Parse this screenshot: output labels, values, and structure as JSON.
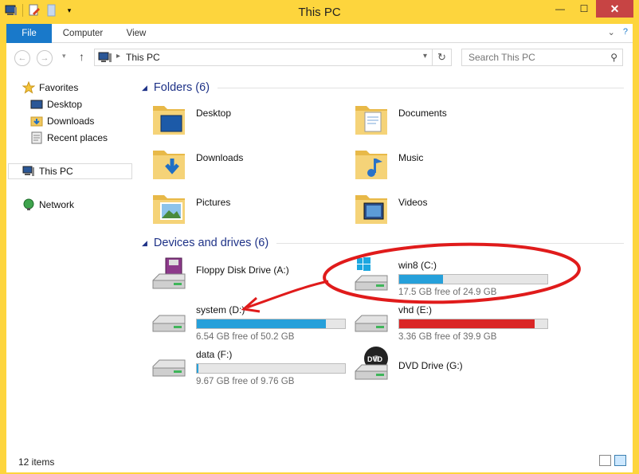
{
  "window": {
    "title": "This PC"
  },
  "ribbon": {
    "tabs": [
      {
        "label": "File"
      },
      {
        "label": "Computer"
      },
      {
        "label": "View"
      }
    ]
  },
  "address": {
    "crumb": "This PC",
    "search_placeholder": "Search This PC"
  },
  "sidebar": {
    "favorites_label": "Favorites",
    "favorites": [
      {
        "label": "Desktop"
      },
      {
        "label": "Downloads"
      },
      {
        "label": "Recent places"
      }
    ],
    "this_pc_label": "This PC",
    "network_label": "Network"
  },
  "folders": {
    "header": "Folders (6)",
    "items": [
      {
        "name": "Desktop",
        "icon": "desktop-folder-icon"
      },
      {
        "name": "Documents",
        "icon": "documents-folder-icon"
      },
      {
        "name": "Downloads",
        "icon": "downloads-folder-icon"
      },
      {
        "name": "Music",
        "icon": "music-folder-icon"
      },
      {
        "name": "Pictures",
        "icon": "pictures-folder-icon"
      },
      {
        "name": "Videos",
        "icon": "videos-folder-icon"
      }
    ]
  },
  "drives": {
    "header": "Devices and drives (6)",
    "items": [
      {
        "name": "Floppy Disk Drive (A:)",
        "icon": "floppy-drive-icon"
      },
      {
        "name": "win8 (C:)",
        "icon": "windows-drive-icon",
        "used_fraction": 0.297,
        "free_text": "17.5 GB free of 24.9 GB"
      },
      {
        "name": "system (D:)",
        "icon": "hard-drive-icon",
        "used_fraction": 0.87,
        "free_text": "6.54 GB free of 50.2 GB"
      },
      {
        "name": "vhd (E:)",
        "icon": "hard-drive-icon",
        "used_fraction": 0.916,
        "free_text": "3.36 GB free of 39.9 GB",
        "bar_color": "#da2626"
      },
      {
        "name": "data (F:)",
        "icon": "hard-drive-icon",
        "used_fraction": 0.009,
        "free_text": "9.67 GB free of 9.76 GB"
      },
      {
        "name": "DVD Drive (G:)",
        "icon": "dvd-drive-icon",
        "badge": "DVD"
      }
    ]
  },
  "status": {
    "count": "12 items"
  },
  "colors": {
    "accent": "#1979ca",
    "bar": "#26a0da",
    "bar_full": "#da2626",
    "annotation": "#e01b1b",
    "titlebar": "#fdd53d"
  }
}
